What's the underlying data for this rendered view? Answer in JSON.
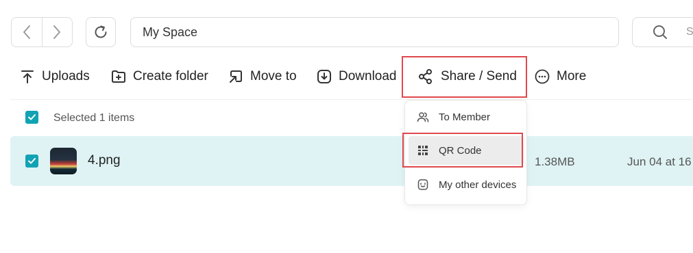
{
  "address": {
    "path": "My Space",
    "search_placeholder": "S"
  },
  "toolbar": {
    "uploads": "Uploads",
    "create_folder": "Create folder",
    "move_to": "Move to",
    "download": "Download",
    "share_send": "Share / Send",
    "more": "More"
  },
  "selection": {
    "text": "Selected 1 items"
  },
  "file": {
    "name": "4.png",
    "size": "1.38MB",
    "date": "Jun 04 at 16"
  },
  "share_menu": {
    "items": [
      {
        "label": "To Member",
        "icon": "members-icon"
      },
      {
        "label": "QR Code",
        "icon": "qr-code-icon"
      },
      {
        "label": "My other devices",
        "icon": "device-icon"
      }
    ]
  },
  "colors": {
    "accent": "#11a3b4",
    "row_highlight": "#dff3f4",
    "annotation_box": "#e0484c"
  }
}
